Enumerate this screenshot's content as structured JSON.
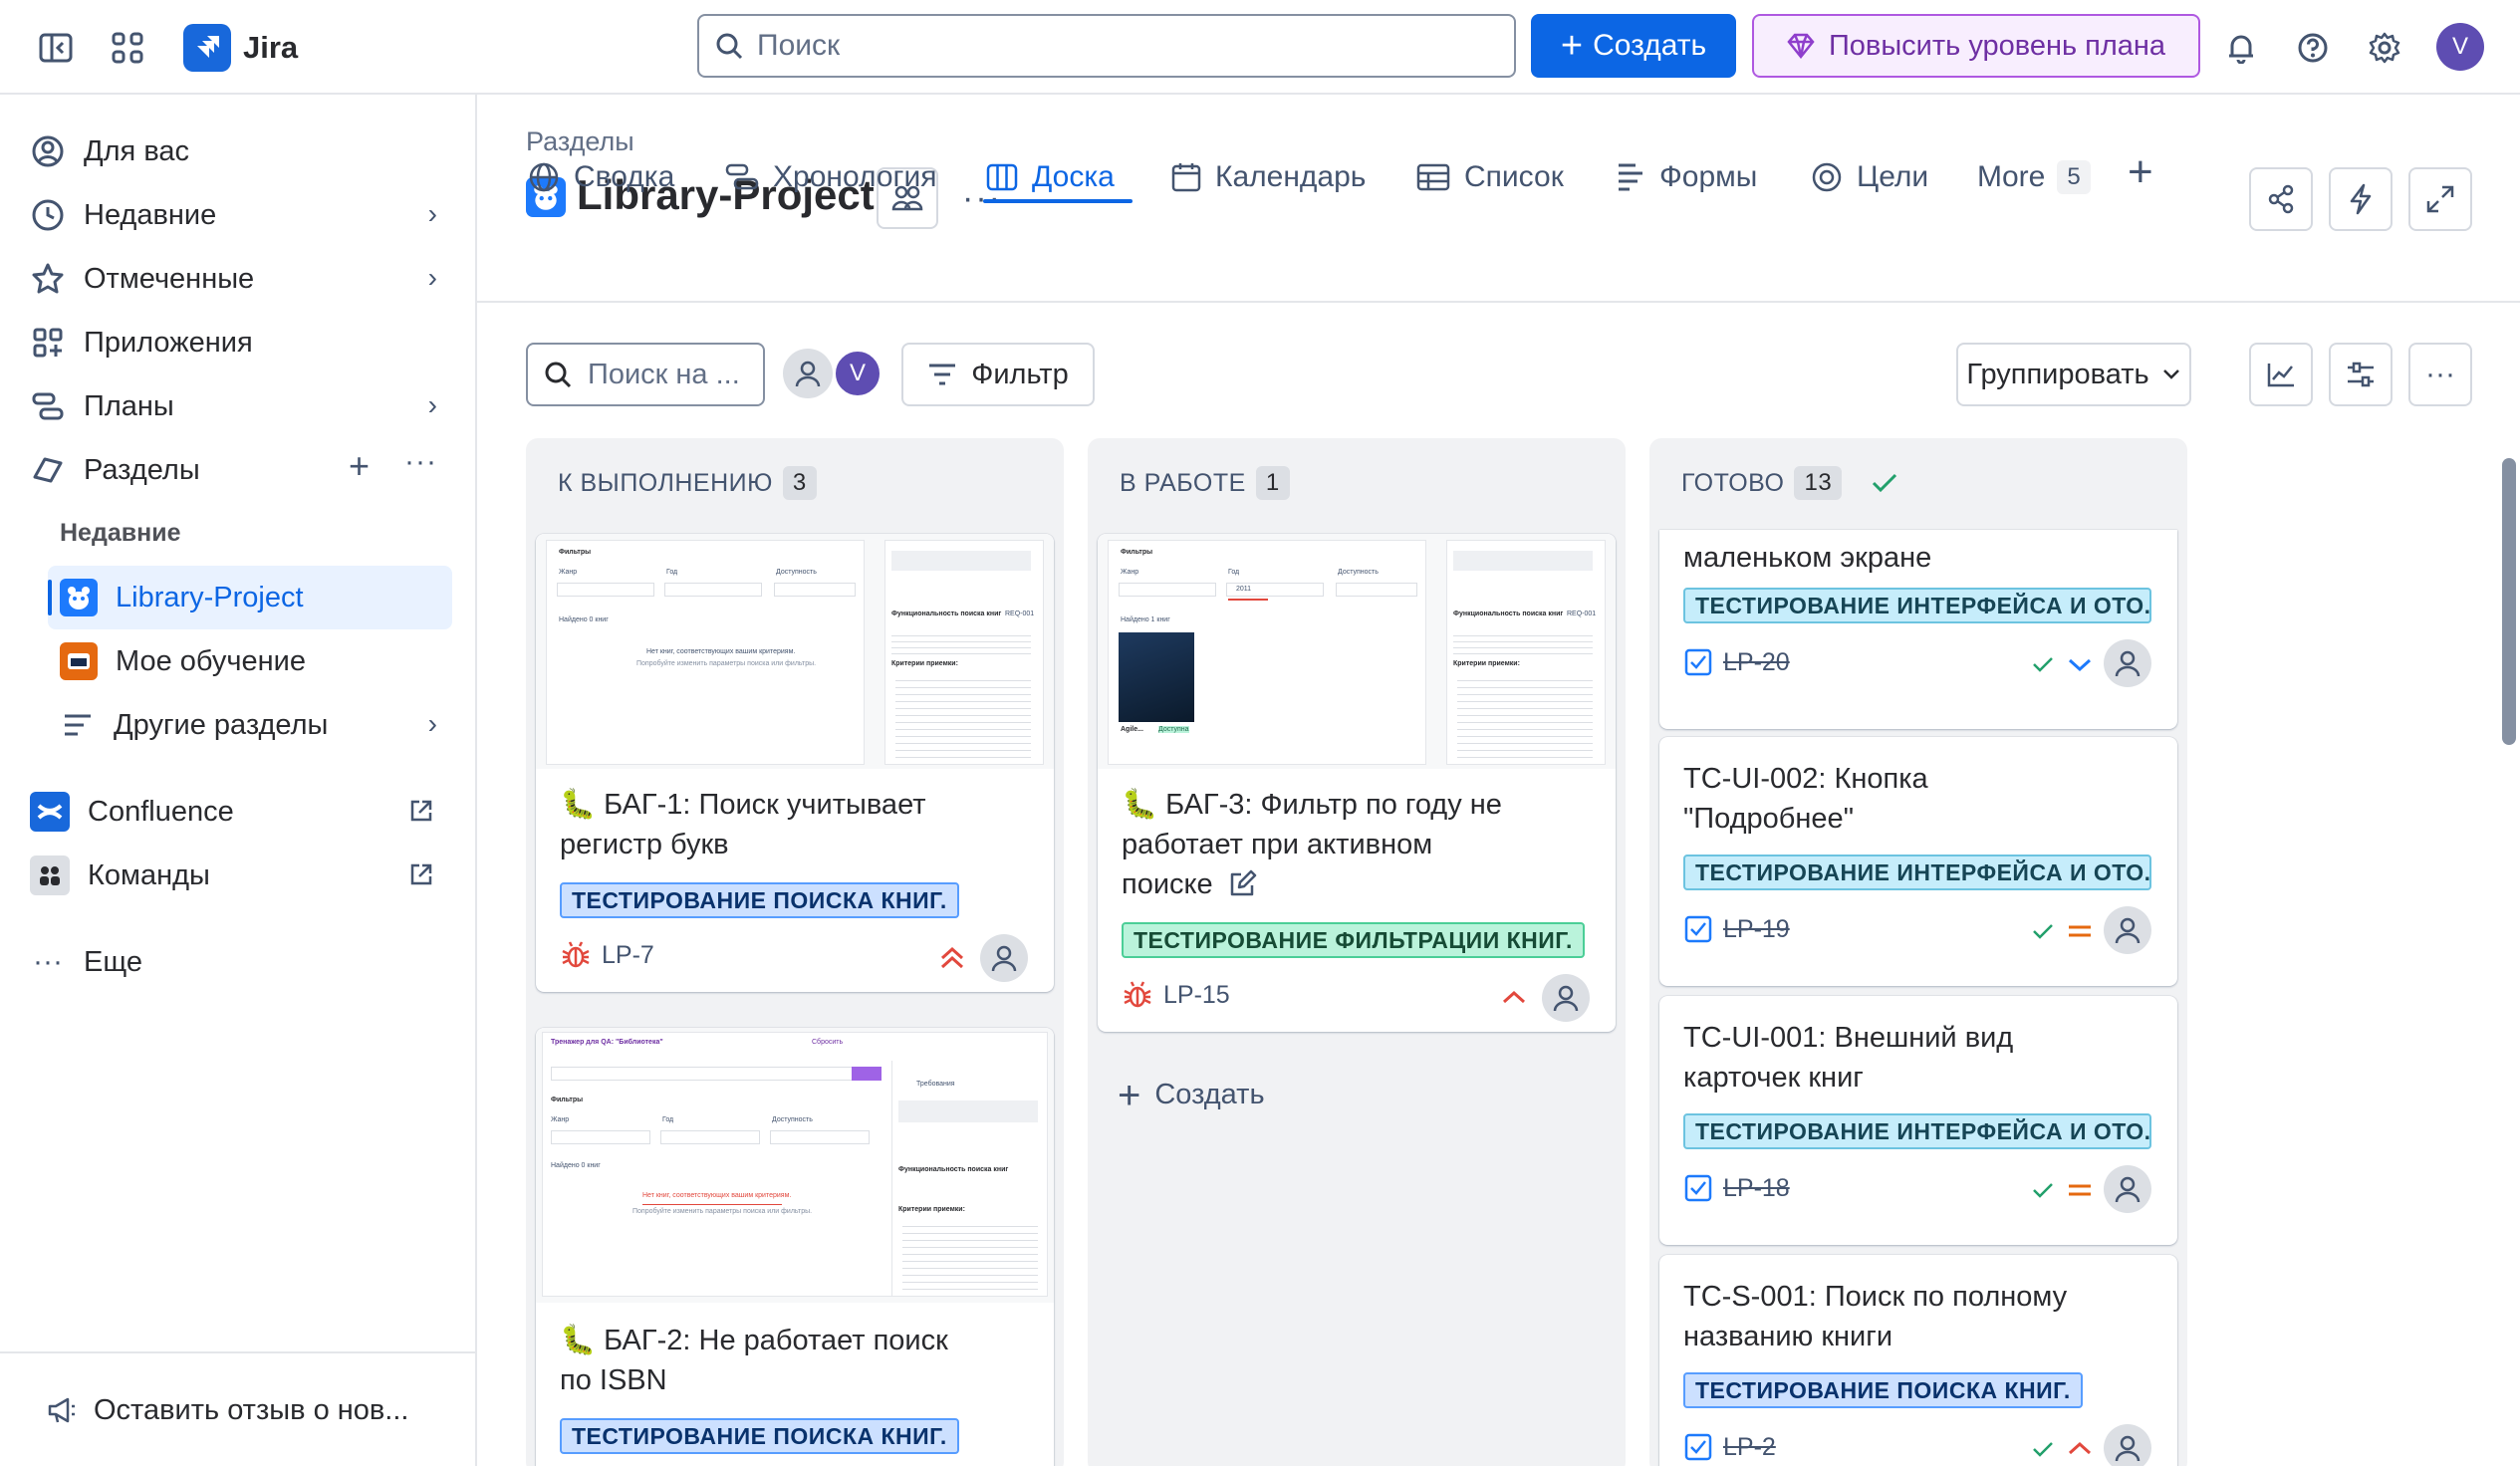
{
  "topbar": {
    "app_name": "Jira",
    "search_placeholder": "Поиск",
    "create_label": "Создать",
    "upgrade_label": "Повысить уровень плана",
    "user_initial": "V"
  },
  "sidebar": {
    "items": [
      {
        "label": "Для вас"
      },
      {
        "label": "Недавние"
      },
      {
        "label": "Отмеченные"
      },
      {
        "label": "Приложения"
      },
      {
        "label": "Планы"
      },
      {
        "label": "Разделы"
      }
    ],
    "recent_heading": "Недавние",
    "spaces": [
      {
        "label": "Library-Project"
      },
      {
        "label": "Мое обучение"
      },
      {
        "label": "Другие разделы"
      }
    ],
    "apps": [
      {
        "label": "Confluence"
      },
      {
        "label": "Команды"
      }
    ],
    "more_label": "Еще",
    "feedback_label": "Оставить отзыв о нов..."
  },
  "header": {
    "breadcrumb": "Разделы",
    "project_title": "Library-Project"
  },
  "tabs": [
    {
      "label": "Сводка"
    },
    {
      "label": "Хронология"
    },
    {
      "label": "Доска"
    },
    {
      "label": "Календарь"
    },
    {
      "label": "Список"
    },
    {
      "label": "Формы"
    },
    {
      "label": "Цели"
    },
    {
      "label": "More",
      "count": "5"
    }
  ],
  "toolbar": {
    "board_search_placeholder": "Поиск на ...",
    "filter_label": "Фильтр",
    "group_label": "Группировать",
    "avatar_initial": "V"
  },
  "columns": [
    {
      "title": "К ВЫПОЛНЕНИЮ",
      "count": "3",
      "cards": [
        {
          "title_line1": "🐛 БАГ-1: Поиск учитывает",
          "title_line2": "регистр букв",
          "label": "ТЕСТИРОВАНИЕ ПОИСКА КНИГ.",
          "key": "LP-7"
        },
        {
          "title_line1": "🐛 БАГ-2: Не работает поиск",
          "title_line2": "по ISBN",
          "label": "ТЕСТИРОВАНИЕ ПОИСКА КНИГ."
        }
      ]
    },
    {
      "title": "В РАБОТЕ",
      "count": "1",
      "cards": [
        {
          "title_line1": "🐛 БАГ-3: Фильтр по году не",
          "title_line2": "работает при активном",
          "title_line3": "поиске",
          "label": "ТЕСТИРОВАНИЕ ФИЛЬТРАЦИИ КНИГ.",
          "key": "LP-15"
        }
      ],
      "create_label": "Создать"
    },
    {
      "title": "ГОТОВО",
      "count": "13",
      "cards": [
        {
          "title_line1": "маленьком экране",
          "label": "ТЕСТИРОВАНИЕ ИНТЕРФЕЙСА И ОТО...",
          "key": "LP-20"
        },
        {
          "title_line1": "TC-UI-002: Кнопка",
          "title_line2": "\"Подробнее\"",
          "label": "ТЕСТИРОВАНИЕ ИНТЕРФЕЙСА И ОТО...",
          "key": "LP-19"
        },
        {
          "title_line1": "TC-UI-001: Внешний вид",
          "title_line2": "карточек книг",
          "label": "ТЕСТИРОВАНИЕ ИНТЕРФЕЙСА И ОТО...",
          "key": "LP-18"
        },
        {
          "title_line1": "TC-S-001: Поиск по полному",
          "title_line2": "названию книги",
          "label": "ТЕСТИРОВАНИЕ ПОИСКА КНИГ.",
          "key": "LP-2"
        }
      ]
    }
  ],
  "thumbnails": {
    "filters": "Фильтры",
    "genre": "Жанр",
    "year": "Год",
    "availability": "Доступность",
    "all_genres": "Все жанры",
    "all_years": "Все годы",
    "available": "Доступные",
    "all": "Все",
    "found_0": "Найдено 0 книг",
    "found_1": "Найдено 1 книг",
    "no_books": "Нет книг, соответствующих вашим критериям.",
    "try_change": "Попробуйте изменить параметры поиска или фильтры.",
    "req_title": "Функциональность поиска книг",
    "req_id": "REQ-001",
    "criteria": "Критерии приемки:",
    "trainer_title": "Тренажер для QA: \"Библиотека\"",
    "reset_label": "Сбросить",
    "requirements_tab": "Требования",
    "year_value": "2011",
    "agile_book": "Agile...",
    "available_badge": "Доступна"
  }
}
